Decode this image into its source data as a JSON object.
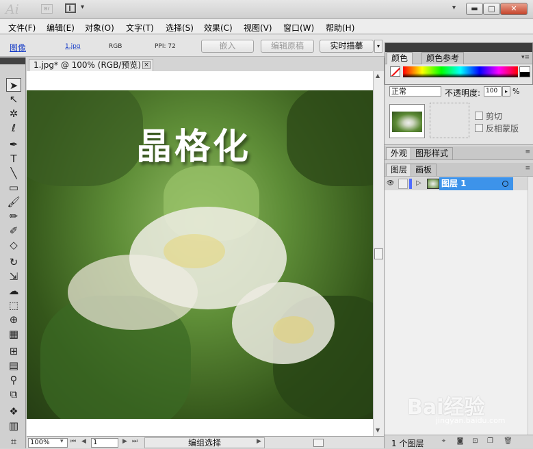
{
  "app": {
    "logo": "Ai",
    "bridge": "Br"
  },
  "window_controls": {
    "minimize": "▬",
    "maximize": "□",
    "close": "✕"
  },
  "menu": [
    "文件(F)",
    "编辑(E)",
    "对象(O)",
    "文字(T)",
    "选择(S)",
    "效果(C)",
    "视图(V)",
    "窗口(W)",
    "帮助(H)"
  ],
  "control_bar": {
    "object_type": "图像",
    "file_name": "1.jpg",
    "color_mode": "RGB",
    "ppi": "PPI: 72",
    "embed_label": "嵌入",
    "edit_original_label": "编辑原稿",
    "live_trace_label": "实时描摹"
  },
  "document_tab": {
    "title": "1.jpg* @ 100% (RGB/预览)",
    "close": "×"
  },
  "artwork": {
    "title_text": "晶格化"
  },
  "status_bar": {
    "zoom": "100%",
    "page": "1",
    "status": "编组选择"
  },
  "color_panel": {
    "tab_color": "颜色",
    "tab_color_guide": "颜色参考"
  },
  "transparency": {
    "blend_mode": "正常",
    "opacity_label": "不透明度:",
    "opacity_value": "100",
    "opacity_unit": "%",
    "clip_label": "剪切",
    "invert_mask_label": "反相蒙版"
  },
  "appearance_tabs": {
    "appearance": "外观",
    "graphic_styles": "图形样式"
  },
  "layers_panel": {
    "tab_layers": "图层",
    "tab_artboards": "画板",
    "layers": [
      {
        "name": "图层 1",
        "color": "#4f6cff"
      }
    ],
    "layer_count": "1 个图层"
  },
  "watermark": {
    "brand": "Bai经验",
    "url": "jingyan.baidu.com"
  },
  "icons": [
    "selection-tool-icon",
    "direct-selection-icon",
    "magic-wand-icon",
    "lasso-icon",
    "pen-icon",
    "type-icon",
    "line-icon",
    "rectangle-icon",
    "paintbrush-icon",
    "pencil-icon",
    "blob-brush-icon",
    "eraser-icon",
    "rotate-icon",
    "scale-icon",
    "warp-icon",
    "free-transform-icon",
    "shape-builder-icon",
    "perspective-icon",
    "mesh-icon",
    "gradient-icon",
    "eyedropper-icon",
    "blend-icon",
    "symbol-sprayer-icon",
    "column-graph-icon",
    "artboard-icon"
  ]
}
